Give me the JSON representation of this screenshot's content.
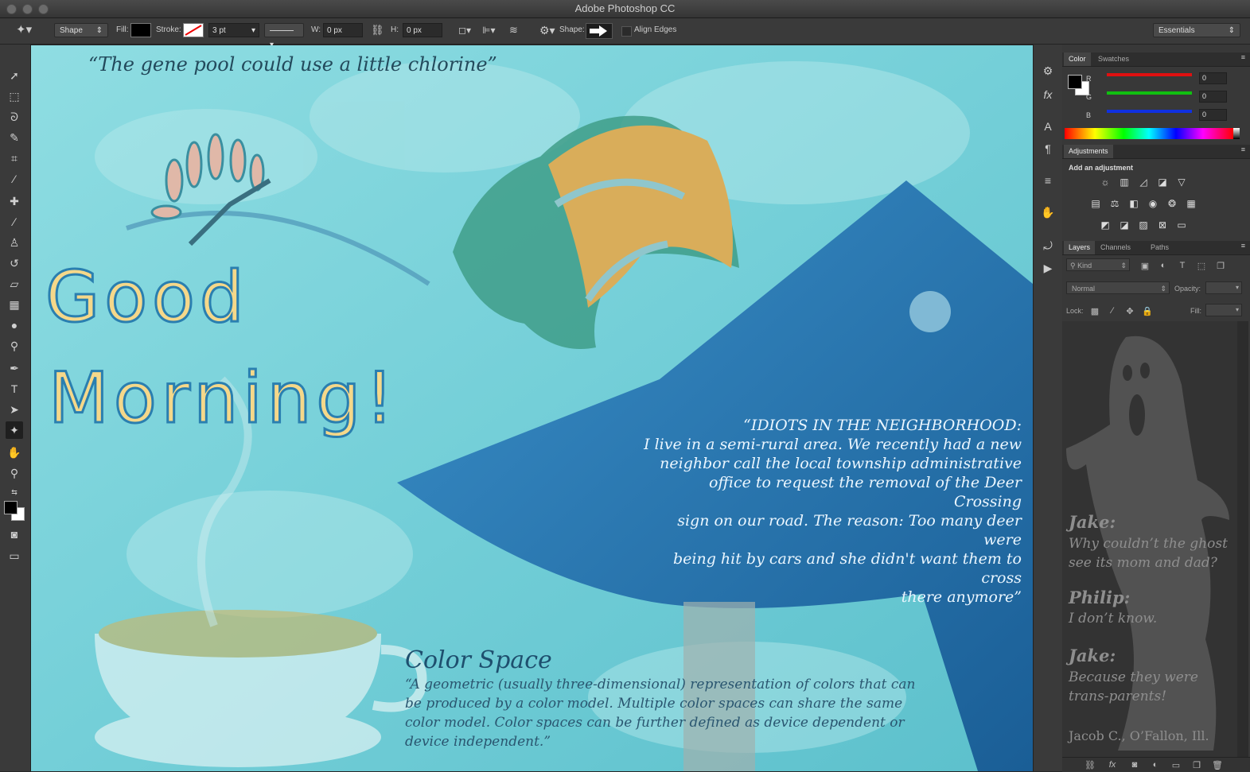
{
  "app": {
    "title": "Adobe Photoshop CC"
  },
  "options": {
    "mode": "Shape",
    "fill_label": "Fill:",
    "stroke_label": "Stroke:",
    "stroke_width": "3 pt",
    "w_label": "W:",
    "w_value": "0 px",
    "h_label": "H:",
    "h_value": "0 px",
    "shape_label": "Shape:",
    "align_edges": "Align Edges",
    "workspace": "Essentials"
  },
  "color_panel": {
    "tabs": [
      "Color",
      "Swatches"
    ],
    "channels": [
      {
        "label": "R",
        "value": "0",
        "color": "#e01010"
      },
      {
        "label": "G",
        "value": "0",
        "color": "#10c010"
      },
      {
        "label": "B",
        "value": "0",
        "color": "#1030e0"
      }
    ]
  },
  "adjustments": {
    "tab": "Adjustments",
    "heading": "Add an adjustment"
  },
  "layers_panel": {
    "tabs": [
      "Layers",
      "Channels",
      "Paths"
    ],
    "kind": "Kind",
    "blend_mode": "Normal",
    "opacity_label": "Opacity:",
    "lock_label": "Lock:",
    "fill_label": "Fill:"
  },
  "canvas": {
    "quote_top": "“The gene pool could use a little chlorine”",
    "good": "Good",
    "morning": "Morning!",
    "idiots_title": "“IDIOTS IN THE NEIGHBORHOOD:",
    "idiots_lines": [
      "I live in a semi-rural area. We  recently had a new",
      "neighbor  call  the  local  township  administrative",
      "office to request the removal of the Deer Crossing",
      "sign on our road. The reason: Too  many deer were",
      "being hit by cars and she didn't want them to cross",
      "there  anymore”"
    ],
    "cs_title": "Color Space",
    "cs_lines": [
      "“A geometric (usually three-dimensional) representation of colors that can",
      "be produced by a color model. Multiple color spaces can share the same",
      "color model. Color spaces can be further defined as device dependent or",
      "device independent.”"
    ]
  },
  "joke": {
    "jake1": "Jake:",
    "q1": "Why couldn’t the ghost",
    "q2": "see its mom and dad?",
    "philip": "Philip:",
    "a1": "I don’t know.",
    "jake2": "Jake:",
    "b1": "Because they were",
    "b2": "trans-parents!",
    "credit": "Jacob C., O’Fallon, Ill."
  }
}
